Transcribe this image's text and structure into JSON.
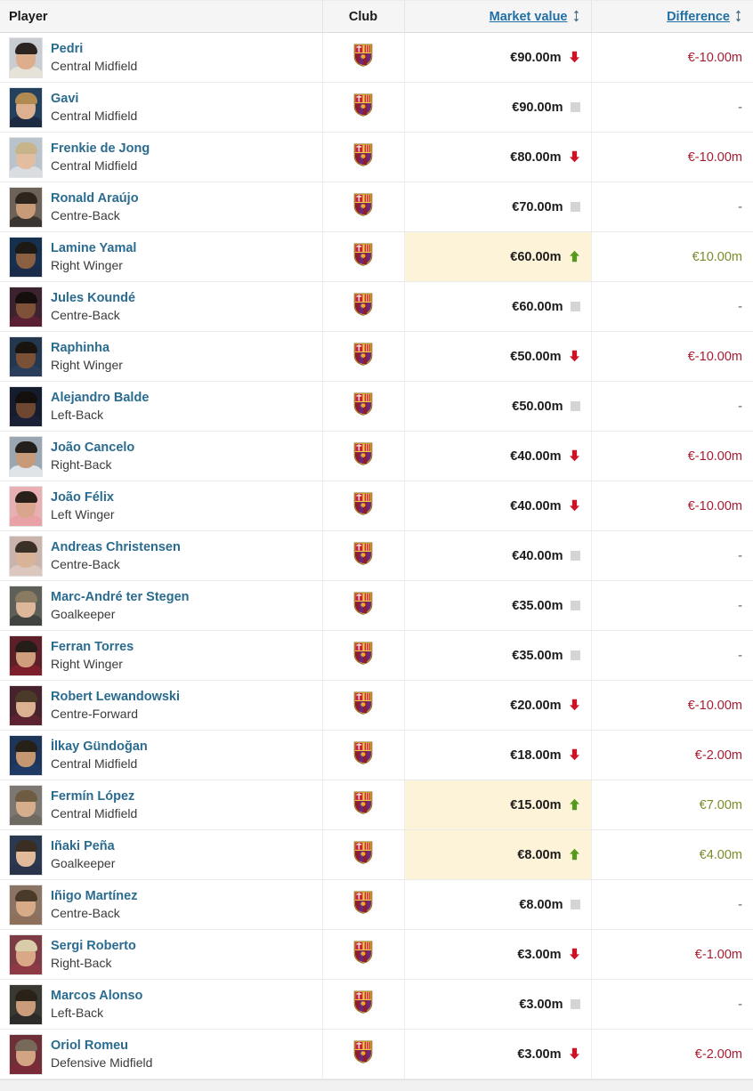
{
  "table": {
    "columns": {
      "player": "Player",
      "club": "Club",
      "market_value": "Market value",
      "difference": "Difference"
    },
    "sort_icon": "sort-updown-icon",
    "club_crest_name": "fc-barcelona-crest",
    "colors": {
      "link": "#2a6b8f",
      "header_bg": "#f5f5f5",
      "highlight_bg": "#fdf3d8",
      "negative": "#a81c31",
      "positive": "#7a8b2b",
      "flat": "#d5d5d5"
    },
    "rows": [
      {
        "name": "Pedri",
        "position": "Central Midfield",
        "club": "FC Barcelona",
        "market_value": "€90.00m",
        "trend": "down",
        "difference": "€-10.00m",
        "diff_type": "neg",
        "highlight": false,
        "photo": {
          "hair": "#2b2420",
          "skin": "#dcae8d",
          "shirt": "#e6e2d8",
          "bg": "#c9ccd0"
        }
      },
      {
        "name": "Gavi",
        "position": "Central Midfield",
        "club": "FC Barcelona",
        "market_value": "€90.00m",
        "trend": "flat",
        "difference": "-",
        "diff_type": "none",
        "highlight": false,
        "photo": {
          "hair": "#b08a50",
          "skin": "#dcb090",
          "shirt": "#1c2a42",
          "bg": "#23405e"
        }
      },
      {
        "name": "Frenkie de Jong",
        "position": "Central Midfield",
        "club": "FC Barcelona",
        "market_value": "€80.00m",
        "trend": "down",
        "difference": "€-10.00m",
        "diff_type": "neg",
        "highlight": false,
        "photo": {
          "hair": "#c8b48a",
          "skin": "#e2bda0",
          "shirt": "#d9dde2",
          "bg": "#b9c3cb"
        }
      },
      {
        "name": "Ronald Araújo",
        "position": "Centre-Back",
        "club": "FC Barcelona",
        "market_value": "€70.00m",
        "trend": "flat",
        "difference": "-",
        "diff_type": "none",
        "highlight": false,
        "photo": {
          "hair": "#2d241e",
          "skin": "#c79a78",
          "shirt": "#3a3530",
          "bg": "#6d6258"
        }
      },
      {
        "name": "Lamine Yamal",
        "position": "Right Winger",
        "club": "FC Barcelona",
        "market_value": "€60.00m",
        "trend": "up",
        "difference": "€10.00m",
        "diff_type": "pos",
        "highlight": true,
        "photo": {
          "hair": "#1d1914",
          "skin": "#8a5f42",
          "shirt": "#1b2b4a",
          "bg": "#16304f"
        }
      },
      {
        "name": "Jules Koundé",
        "position": "Centre-Back",
        "club": "FC Barcelona",
        "market_value": "€60.00m",
        "trend": "flat",
        "difference": "-",
        "diff_type": "none",
        "highlight": false,
        "photo": {
          "hair": "#140f0c",
          "skin": "#7d5238",
          "shirt": "#5b1f33",
          "bg": "#3d2330"
        }
      },
      {
        "name": "Raphinha",
        "position": "Right Winger",
        "club": "FC Barcelona",
        "market_value": "€50.00m",
        "trend": "down",
        "difference": "€-10.00m",
        "diff_type": "neg",
        "highlight": false,
        "photo": {
          "hair": "#191410",
          "skin": "#7a5037",
          "shirt": "#2a3e5c",
          "bg": "#23374f"
        }
      },
      {
        "name": "Alejandro Balde",
        "position": "Left-Back",
        "club": "FC Barcelona",
        "market_value": "€50.00m",
        "trend": "flat",
        "difference": "-",
        "diff_type": "none",
        "highlight": false,
        "photo": {
          "hair": "#130f0c",
          "skin": "#6d4730",
          "shirt": "#1a2136",
          "bg": "#141c2e"
        }
      },
      {
        "name": "João Cancelo",
        "position": "Right-Back",
        "club": "FC Barcelona",
        "market_value": "€40.00m",
        "trend": "down",
        "difference": "€-10.00m",
        "diff_type": "neg",
        "highlight": false,
        "photo": {
          "hair": "#23201c",
          "skin": "#c79b79",
          "shirt": "#dfe4e9",
          "bg": "#9aa7b2"
        }
      },
      {
        "name": "João Félix",
        "position": "Left Winger",
        "club": "FC Barcelona",
        "market_value": "€40.00m",
        "trend": "down",
        "difference": "€-10.00m",
        "diff_type": "neg",
        "highlight": false,
        "photo": {
          "hair": "#2a201a",
          "skin": "#d9a58c",
          "shirt": "#e8a2a6",
          "bg": "#e9b0b4"
        }
      },
      {
        "name": "Andreas Christensen",
        "position": "Centre-Back",
        "club": "FC Barcelona",
        "market_value": "€40.00m",
        "trend": "flat",
        "difference": "-",
        "diff_type": "none",
        "highlight": false,
        "photo": {
          "hair": "#3a3028",
          "skin": "#d9b397",
          "shirt": "#dcc7bf",
          "bg": "#c9b3ab"
        }
      },
      {
        "name": "Marc-André ter Stegen",
        "position": "Goalkeeper",
        "club": "FC Barcelona",
        "market_value": "€35.00m",
        "trend": "flat",
        "difference": "-",
        "diff_type": "none",
        "highlight": false,
        "photo": {
          "hair": "#8a7a62",
          "skin": "#dcb79a",
          "shirt": "#40433f",
          "bg": "#5c6059"
        }
      },
      {
        "name": "Ferran Torres",
        "position": "Right Winger",
        "club": "FC Barcelona",
        "market_value": "€35.00m",
        "trend": "flat",
        "difference": "-",
        "diff_type": "none",
        "highlight": false,
        "photo": {
          "hair": "#241d18",
          "skin": "#cf9f7d",
          "shirt": "#7d1f2a",
          "bg": "#5e2028"
        }
      },
      {
        "name": "Robert Lewandowski",
        "position": "Centre-Forward",
        "club": "FC Barcelona",
        "market_value": "€20.00m",
        "trend": "down",
        "difference": "€-10.00m",
        "diff_type": "neg",
        "highlight": false,
        "photo": {
          "hair": "#4c3a28",
          "skin": "#dcb191",
          "shirt": "#5d2230",
          "bg": "#46222c"
        }
      },
      {
        "name": "İlkay Gündoğan",
        "position": "Central Midfield",
        "club": "FC Barcelona",
        "market_value": "€18.00m",
        "trend": "down",
        "difference": "€-2.00m",
        "diff_type": "neg",
        "highlight": false,
        "photo": {
          "hair": "#262018",
          "skin": "#c59672",
          "shirt": "#203a66",
          "bg": "#1d3559"
        }
      },
      {
        "name": "Fermín López",
        "position": "Central Midfield",
        "club": "FC Barcelona",
        "market_value": "€15.00m",
        "trend": "up",
        "difference": "€7.00m",
        "diff_type": "pos",
        "highlight": true,
        "photo": {
          "hair": "#6d5b42",
          "skin": "#d6ae8c",
          "shirt": "#6e6a62",
          "bg": "#7c7770"
        }
      },
      {
        "name": "Iñaki Peña",
        "position": "Goalkeeper",
        "club": "FC Barcelona",
        "market_value": "€8.00m",
        "trend": "up",
        "difference": "€4.00m",
        "diff_type": "pos",
        "highlight": true,
        "photo": {
          "hair": "#3a2e22",
          "skin": "#e0ba9a",
          "shirt": "#29344a",
          "bg": "#2b3950"
        }
      },
      {
        "name": "Iñigo Martínez",
        "position": "Centre-Back",
        "club": "FC Barcelona",
        "market_value": "€8.00m",
        "trend": "flat",
        "difference": "-",
        "diff_type": "none",
        "highlight": false,
        "photo": {
          "hair": "#4a3a2a",
          "skin": "#d8ab88",
          "shirt": "#8d6f5b",
          "bg": "#8b7463"
        }
      },
      {
        "name": "Sergi Roberto",
        "position": "Right-Back",
        "club": "FC Barcelona",
        "market_value": "€3.00m",
        "trend": "down",
        "difference": "€-1.00m",
        "diff_type": "neg",
        "highlight": false,
        "photo": {
          "hair": "#d8cda8",
          "skin": "#d8a887",
          "shirt": "#8d3a45",
          "bg": "#7d3c45"
        }
      },
      {
        "name": "Marcos Alonso",
        "position": "Left-Back",
        "club": "FC Barcelona",
        "market_value": "€3.00m",
        "trend": "flat",
        "difference": "-",
        "diff_type": "none",
        "highlight": false,
        "photo": {
          "hair": "#2a2119",
          "skin": "#cb9c7a",
          "shirt": "#2c2b2a",
          "bg": "#3a3833"
        }
      },
      {
        "name": "Oriol Romeu",
        "position": "Defensive Midfield",
        "club": "FC Barcelona",
        "market_value": "€3.00m",
        "trend": "down",
        "difference": "€-2.00m",
        "diff_type": "neg",
        "highlight": false,
        "photo": {
          "hair": "#77695a",
          "skin": "#d2a483",
          "shirt": "#7b2b38",
          "bg": "#6e2f38"
        }
      }
    ]
  }
}
